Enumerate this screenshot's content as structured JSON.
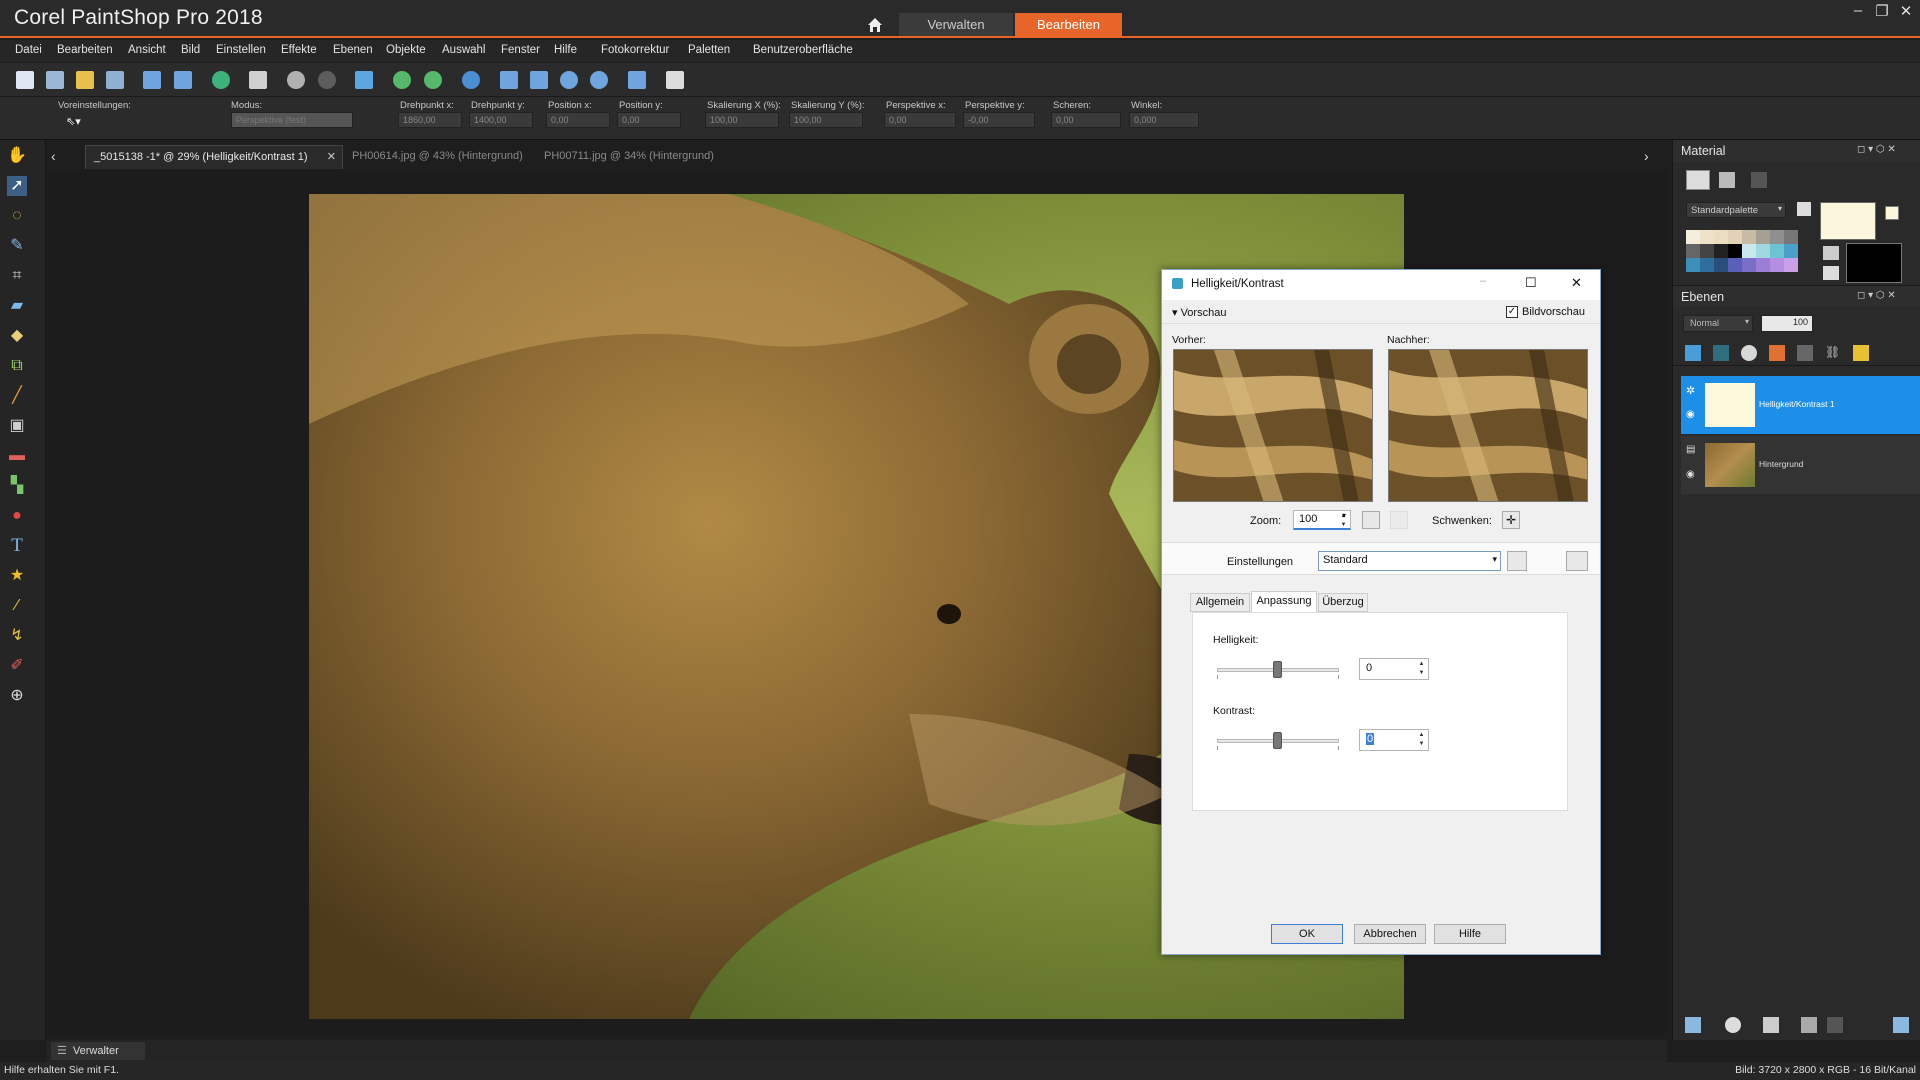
{
  "app": {
    "title": "Corel PaintShop Pro 2018",
    "workspace_tabs": [
      {
        "label": "Verwalten"
      },
      {
        "label": "Bearbeiten"
      }
    ],
    "accent": "#e8652a"
  },
  "menu": [
    "Datei",
    "Bearbeiten",
    "Ansicht",
    "Bild",
    "Einstellen",
    "Effekte",
    "Ebenen",
    "Objekte",
    "Auswahl",
    "Fenster",
    "Hilfe",
    "Fotokorrektur",
    "Paletten",
    "Benutzeroberfläche"
  ],
  "tool_options": {
    "presets_label": "Voreinstellungen:",
    "mode_label": "Modus:",
    "mode_value": "Perspektive (fest)",
    "fields": [
      {
        "label": "Drehpunkt x:",
        "value": "1860,00"
      },
      {
        "label": "Drehpunkt y:",
        "value": "1400,00"
      },
      {
        "label": "Position x:",
        "value": "0,00"
      },
      {
        "label": "Position y:",
        "value": "0,00"
      },
      {
        "label": "Skalierung X (%):",
        "value": "100,00"
      },
      {
        "label": "Skalierung Y (%):",
        "value": "100,00"
      },
      {
        "label": "Perspektive x:",
        "value": "0,00"
      },
      {
        "label": "Perspektive y:",
        "value": "-0,00"
      },
      {
        "label": "Scheren:",
        "value": "0,00"
      },
      {
        "label": "Winkel:",
        "value": "0,000"
      }
    ]
  },
  "doc_tabs": [
    {
      "label": "_5015138 -1* @  29% (Helligkeit/Kontrast 1)"
    },
    {
      "label": "PH00614.jpg @  43% (Hintergrund)"
    },
    {
      "label": "PH00711.jpg @  34% (Hintergrund)"
    }
  ],
  "material": {
    "title": "Material",
    "palette": "Standardpalette"
  },
  "layers": {
    "title": "Ebenen",
    "blend_mode": "Normal",
    "opacity": "100",
    "items": [
      {
        "name": "Helligkeit/Kontrast 1"
      },
      {
        "name": "Hintergrund"
      }
    ]
  },
  "dialog": {
    "title": "Helligkeit/Kontrast",
    "preview_toggle": "Vorschau",
    "image_preview_label": "Bildvorschau",
    "before_label": "Vorher:",
    "after_label": "Nachher:",
    "zoom_label": "Zoom:",
    "zoom_value": "100",
    "pan_label": "Schwenken:",
    "settings_label": "Einstellungen",
    "settings_value": "Standard",
    "tabs": [
      {
        "label": "Allgemein"
      },
      {
        "label": "Anpassung"
      },
      {
        "label": "Überzug"
      }
    ],
    "brightness_label": "Helligkeit:",
    "brightness_value": "0",
    "contrast_label": "Kontrast:",
    "contrast_value": "0",
    "ok": "OK",
    "cancel": "Abbrechen",
    "help": "Hilfe"
  },
  "bottom": {
    "organizer_label": "Verwalter"
  },
  "status": {
    "left": "Hilfe erhalten Sie mit F1.",
    "right": "Bild:  3720 x 2800 x RGB - 16 Bit/Kanal"
  }
}
